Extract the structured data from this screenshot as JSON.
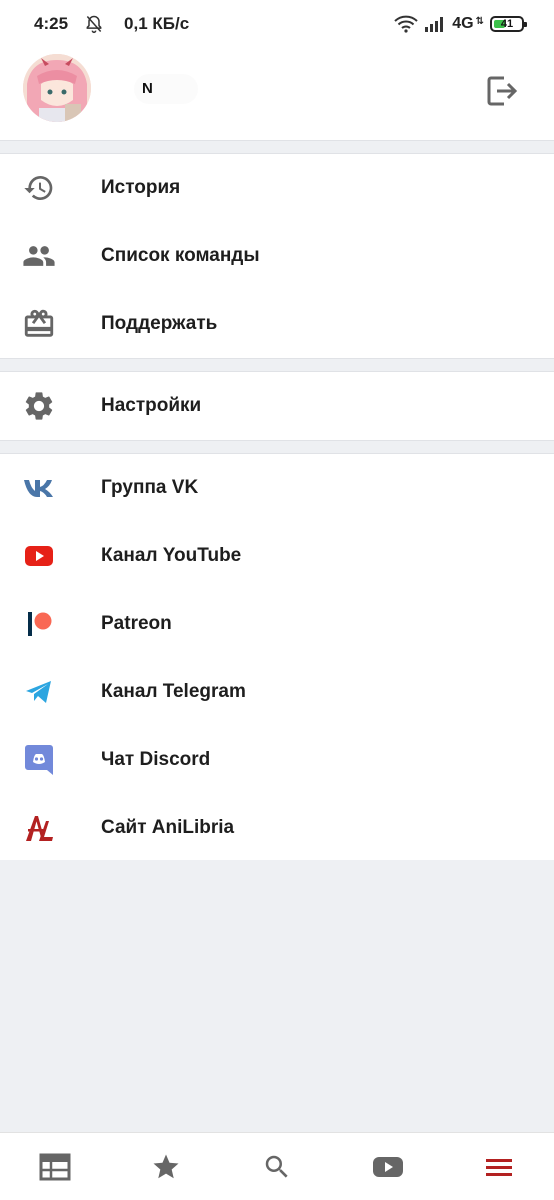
{
  "status_bar": {
    "time": "4:25",
    "network_speed": "0,1 КБ/с",
    "network_type": "4G",
    "battery_level": "41",
    "battery_fraction": 0.41,
    "icons": [
      "bell-off-icon",
      "wifi-icon",
      "signal-icon",
      "battery-icon"
    ]
  },
  "profile": {
    "username": "N",
    "logout_icon": "logout-icon"
  },
  "menu": {
    "main": [
      {
        "label": "История",
        "icon": "history-icon"
      },
      {
        "label": "Список команды",
        "icon": "team-icon"
      },
      {
        "label": "Поддержать",
        "icon": "gift-icon"
      }
    ],
    "settings": [
      {
        "label": "Настройки",
        "icon": "gear-icon"
      }
    ],
    "links": [
      {
        "label": "Группа VK",
        "icon": "vk-icon",
        "color": "#4a76a8"
      },
      {
        "label": "Канал YouTube",
        "icon": "youtube-icon",
        "color": "#e62117"
      },
      {
        "label": "Patreon",
        "icon": "patreon-icon",
        "color": "#f96854"
      },
      {
        "label": "Канал Telegram",
        "icon": "telegram-icon",
        "color": "#2ca5e0"
      },
      {
        "label": "Чат Discord",
        "icon": "discord-icon",
        "color": "#7289da"
      },
      {
        "label": "Сайт AniLibria",
        "icon": "anilibria-icon",
        "color": "#b32121"
      }
    ]
  },
  "bottom_nav": [
    {
      "name": "schedule",
      "icon": "calendar-icon",
      "active": false
    },
    {
      "name": "favorites",
      "icon": "star-icon",
      "active": false
    },
    {
      "name": "search",
      "icon": "search-icon",
      "active": false
    },
    {
      "name": "youtube",
      "icon": "video-icon",
      "active": false
    },
    {
      "name": "menu",
      "icon": "menu-icon",
      "active": true
    }
  ],
  "colors": {
    "accent": "#b32121",
    "icon_gray": "#6b6b6b",
    "background": "#eef0f3"
  }
}
